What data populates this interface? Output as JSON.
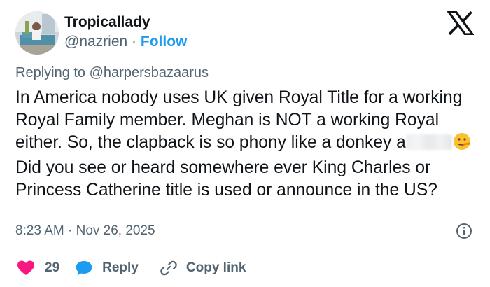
{
  "author": {
    "name": "Tropicallady",
    "handle": "@nazrien",
    "separator": "·",
    "follow_label": "Follow"
  },
  "reply_context": {
    "prefix": "Replying to",
    "mention": "@harpersbazaarus"
  },
  "tweet": {
    "text_part1": "In America nobody uses UK given Royal Title for a working Royal Family member. Meghan is NOT a working Royal either. So, the clapback is so phony like a donkey a",
    "text_part2": "Did you see or heard somewhere ever King Charles or Princess Catherine title is used or announce in the US?"
  },
  "meta": {
    "timestamp": "8:23 AM · Nov 26, 2025"
  },
  "actions": {
    "like_count": "29",
    "reply_label": "Reply",
    "copy_label": "Copy link"
  },
  "icons": {
    "brand": "x-logo-icon",
    "info": "info-icon",
    "like": "heart-icon",
    "reply": "speech-bubble-icon",
    "copy": "link-icon",
    "emoji": "lying-face-emoji-icon"
  },
  "colors": {
    "text": "#0f1419",
    "muted": "#536471",
    "link": "#1d9bf0",
    "like": "#f91880"
  }
}
